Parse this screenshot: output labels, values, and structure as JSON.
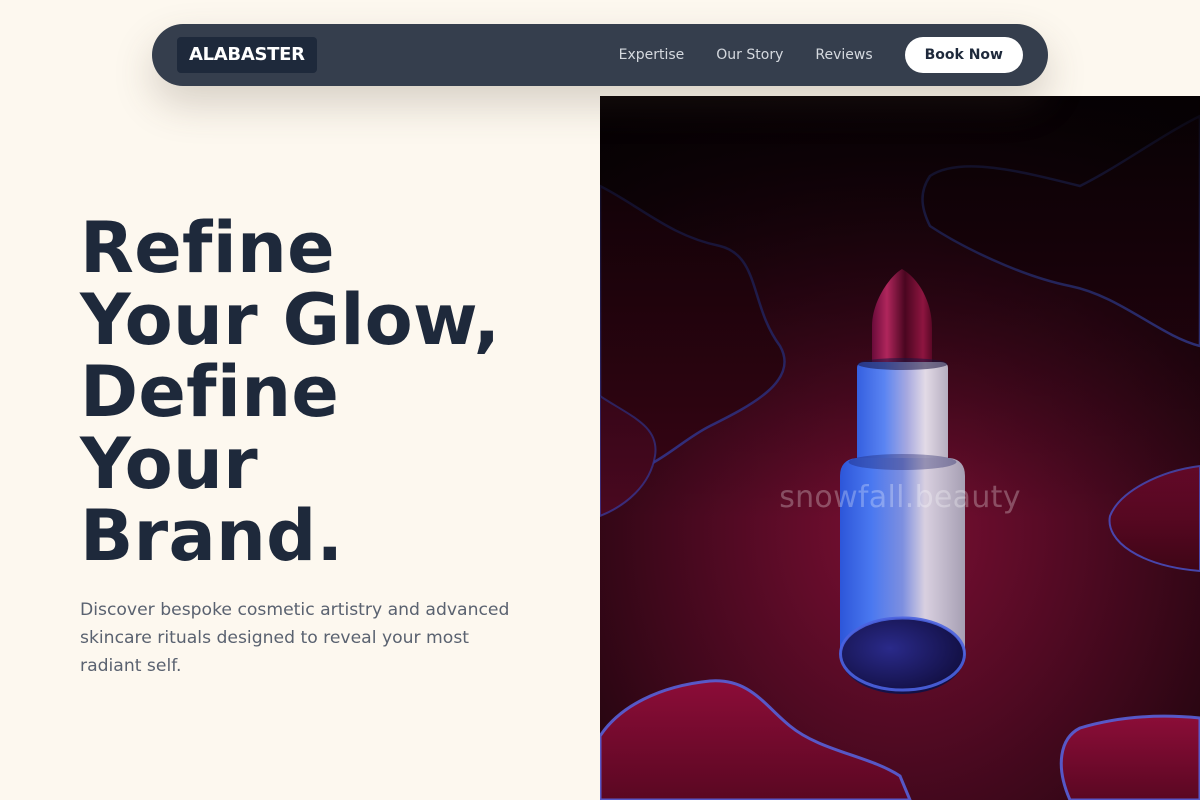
{
  "brand": {
    "logo_text": "ALABASTER"
  },
  "nav": {
    "links": [
      {
        "label": "Expertise"
      },
      {
        "label": "Our Story"
      },
      {
        "label": "Reviews"
      }
    ],
    "cta_label": "Book Now"
  },
  "hero": {
    "title_lines": [
      "Refine",
      "Your Glow,",
      "Define",
      "Your",
      "Brand."
    ],
    "description": "Discover bespoke cosmetic artistry and advanced skincare rituals designed to reveal your most radiant self.",
    "image": {
      "watermark": "snowfall.beauty"
    }
  },
  "colors": {
    "page_background": "#fdf8ef",
    "nav_background": "#353e4d",
    "logo_background": "#1e293b",
    "heading": "#1e293b",
    "body_text": "#5a6270",
    "cta_background": "#ffffff"
  }
}
